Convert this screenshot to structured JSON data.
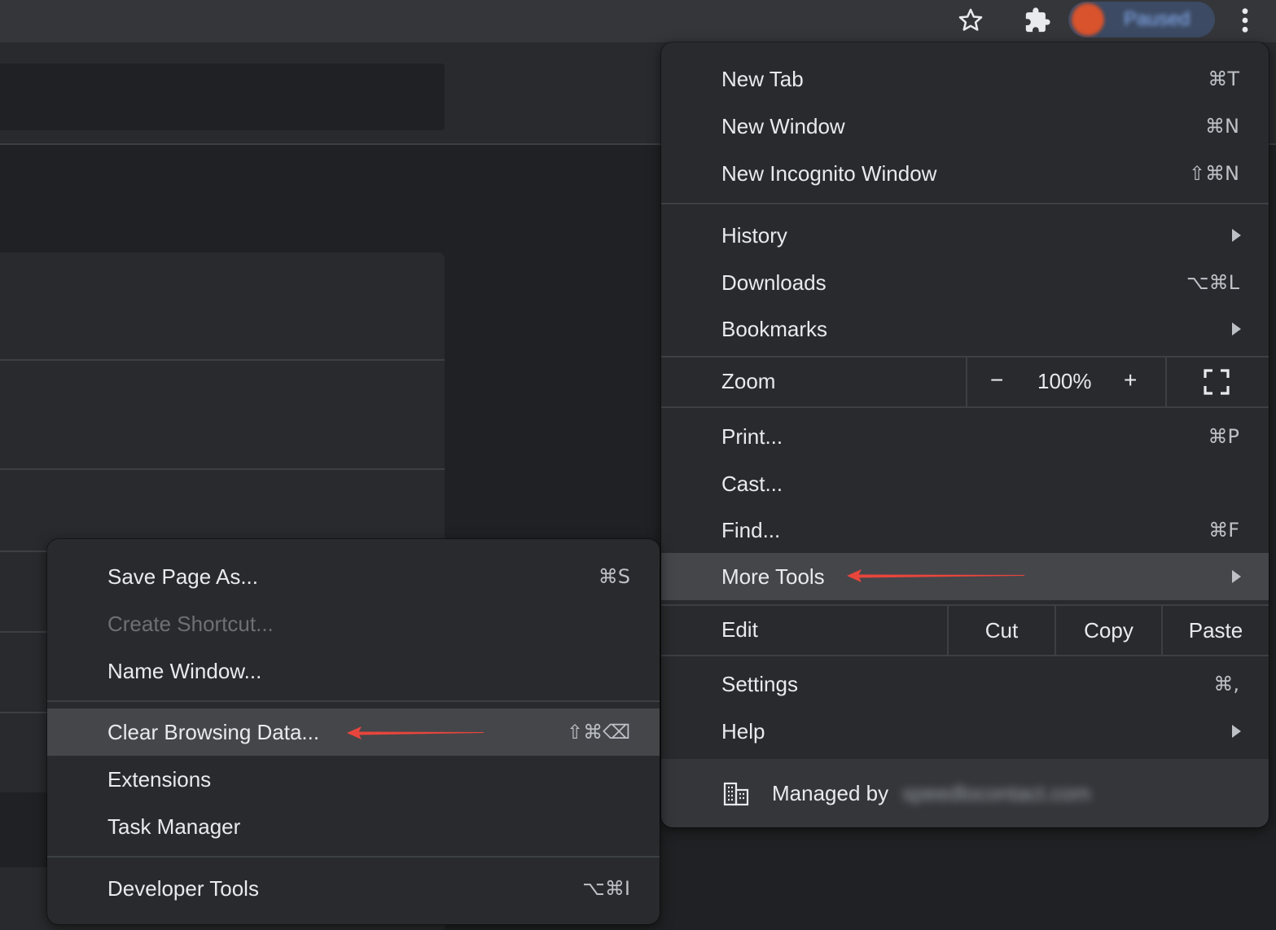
{
  "toolbar": {
    "bookmark_icon": "star-icon",
    "extensions_icon": "puzzle-icon",
    "profile_label": "Paused",
    "menu_icon": "kebab-icon"
  },
  "main_menu": {
    "items": [
      {
        "label": "New Tab",
        "shortcut": "⌘T"
      },
      {
        "label": "New Window",
        "shortcut": "⌘N"
      },
      {
        "label": "New Incognito Window",
        "shortcut": "⇧⌘N"
      },
      {
        "label": "History",
        "shortcut": ""
      },
      {
        "label": "Downloads",
        "shortcut": "⌥⌘L"
      },
      {
        "label": "Bookmarks",
        "shortcut": ""
      },
      {
        "label": "Print...",
        "shortcut": "⌘P"
      },
      {
        "label": "Cast...",
        "shortcut": ""
      },
      {
        "label": "Find...",
        "shortcut": "⌘F"
      },
      {
        "label": "More Tools",
        "shortcut": ""
      },
      {
        "label": "Settings",
        "shortcut": "⌘,"
      },
      {
        "label": "Help",
        "shortcut": ""
      }
    ],
    "zoom": {
      "label": "Zoom",
      "minus": "−",
      "value": "100%",
      "plus": "+"
    },
    "edit": {
      "label": "Edit",
      "cut": "Cut",
      "copy": "Copy",
      "paste": "Paste"
    },
    "managed": {
      "label": "Managed by",
      "domain": "speedlocontact.com"
    }
  },
  "sub_menu": {
    "items": [
      {
        "label": "Save Page As...",
        "shortcut": "⌘S",
        "enabled": true
      },
      {
        "label": "Create Shortcut...",
        "shortcut": "",
        "enabled": false
      },
      {
        "label": "Name Window...",
        "shortcut": "",
        "enabled": true
      },
      {
        "label": "Clear Browsing Data...",
        "shortcut": "⇧⌘⌫",
        "enabled": true
      },
      {
        "label": "Extensions",
        "shortcut": "",
        "enabled": true
      },
      {
        "label": "Task Manager",
        "shortcut": "",
        "enabled": true
      },
      {
        "label": "Developer Tools",
        "shortcut": "⌥⌘I",
        "enabled": true
      }
    ]
  },
  "colors": {
    "background": "#202124",
    "menu": "#292a2d",
    "highlight": "#45464a",
    "annotation": "#e8453c"
  }
}
